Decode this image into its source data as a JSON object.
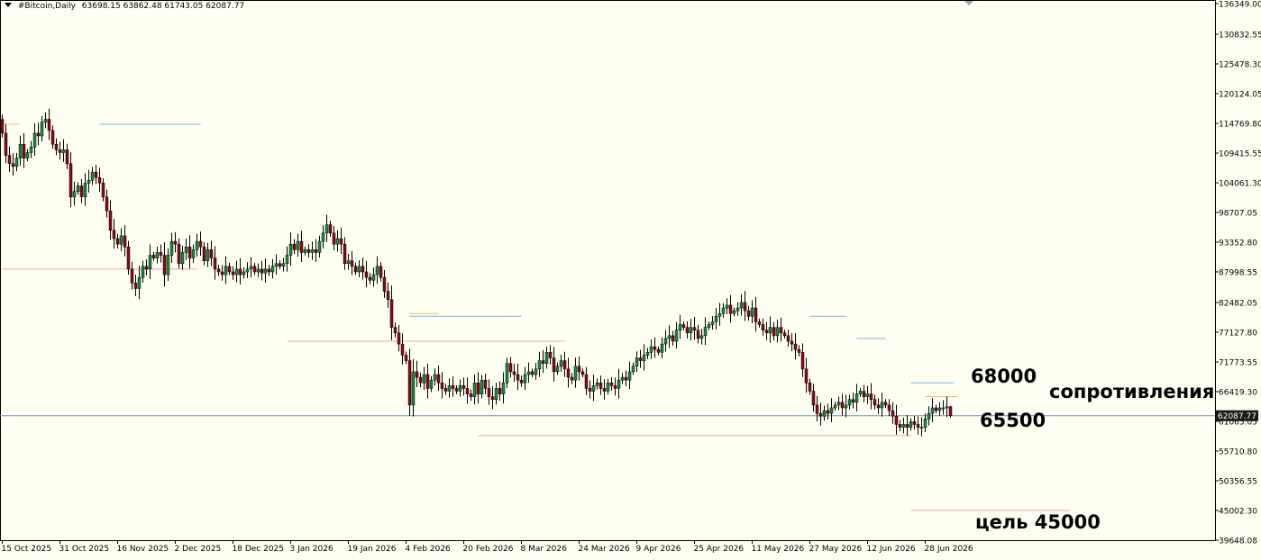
{
  "header": {
    "symbol": "#Bitcoin,Daily",
    "ohlc": "63698.15 63862.48 61743.05 62087.77"
  },
  "colors": {
    "background": "#fffff2",
    "bull": "#1e8c3a",
    "bear": "#8b0a17",
    "wick": "#000000",
    "current_price_line": "#7a8fb8",
    "current_price_box": "#1a1a1a",
    "level_orange": "#f0b860",
    "level_blue": "#7fb3e6",
    "level_red": "#f0a8a8"
  },
  "annotations": {
    "a68000": "68000",
    "a65500": "65500",
    "resistance": "сопротивления",
    "target": "цель 45000"
  },
  "chart_data": {
    "type": "candlestick",
    "timeframe": "Daily",
    "symbol": "#Bitcoin",
    "current_price": 62087.77,
    "current_price_label": "62087.77",
    "ylim": [
      39648.08,
      136349.0
    ],
    "y_ticks": [
      {
        "v": 136349.0,
        "label": "136349.00"
      },
      {
        "v": 130832.55,
        "label": "130832.55"
      },
      {
        "v": 125478.3,
        "label": "125478.30"
      },
      {
        "v": 120124.05,
        "label": "120124.05"
      },
      {
        "v": 114769.8,
        "label": "114769.80"
      },
      {
        "v": 109415.55,
        "label": "109415.55"
      },
      {
        "v": 104061.3,
        "label": "104061.30"
      },
      {
        "v": 98707.05,
        "label": "98707.05"
      },
      {
        "v": 93352.8,
        "label": "93352.80"
      },
      {
        "v": 87998.55,
        "label": "87998.55"
      },
      {
        "v": 82482.05,
        "label": "82482.05"
      },
      {
        "v": 77127.8,
        "label": "77127.80"
      },
      {
        "v": 71773.55,
        "label": "71773.55"
      },
      {
        "v": 66419.3,
        "label": "66419.30"
      },
      {
        "v": 61065.05,
        "label": "61065.05"
      },
      {
        "v": 55710.8,
        "label": "55710.80"
      },
      {
        "v": 50356.55,
        "label": "50356.55"
      },
      {
        "v": 45002.3,
        "label": "45002.30"
      },
      {
        "v": 39648.08,
        "label": "39648.08"
      }
    ],
    "x_labels": [
      "15 Oct 2025",
      "31 Oct 2025",
      "16 Nov 2025",
      "2 Dec 2025",
      "18 Dec 2025",
      "3 Jan 2026",
      "19 Jan 2026",
      "4 Feb 2026",
      "20 Feb 2026",
      "8 Mar 2026",
      "24 Mar 2026",
      "9 Apr 2026",
      "25 Apr 2026",
      "11 May 2026",
      "27 May 2026",
      "12 Jun 2026",
      "28 Jun 2026"
    ],
    "dates": [
      "2025-10-15",
      "2025-10-16",
      "2025-10-17",
      "2025-10-18",
      "2025-10-19",
      "2025-10-20",
      "2025-10-21",
      "2025-10-22",
      "2025-10-23",
      "2025-10-24",
      "2025-10-25",
      "2025-10-26",
      "2025-10-27",
      "2025-10-28",
      "2025-10-29",
      "2025-10-30",
      "2025-10-31",
      "2025-11-01",
      "2025-11-02",
      "2025-11-03",
      "2025-11-04",
      "2025-11-05",
      "2025-11-06",
      "2025-11-07",
      "2025-11-08",
      "2025-11-09",
      "2025-11-10",
      "2025-11-11",
      "2025-11-12",
      "2025-11-13",
      "2025-11-14",
      "2025-11-15",
      "2025-11-16",
      "2025-11-17",
      "2025-11-18",
      "2025-11-19",
      "2025-11-20",
      "2025-11-21",
      "2025-11-22",
      "2025-11-23",
      "2025-11-24",
      "2025-11-25",
      "2025-11-26",
      "2025-11-27",
      "2025-11-28",
      "2025-11-29",
      "2025-11-30",
      "2025-12-01",
      "2025-12-02",
      "2025-12-03",
      "2025-12-04",
      "2025-12-05",
      "2025-12-06",
      "2025-12-07",
      "2025-12-08",
      "2025-12-09",
      "2025-12-10",
      "2025-12-11",
      "2025-12-12",
      "2025-12-13",
      "2025-12-14",
      "2025-12-15",
      "2025-12-16",
      "2025-12-17",
      "2025-12-18",
      "2025-12-19",
      "2025-12-20",
      "2025-12-21",
      "2025-12-22",
      "2025-12-23",
      "2025-12-24",
      "2025-12-25",
      "2025-12-26",
      "2025-12-27",
      "2025-12-28",
      "2025-12-29",
      "2025-12-30",
      "2025-12-31",
      "2026-01-01",
      "2026-01-02",
      "2026-01-03",
      "2026-01-04",
      "2026-01-05",
      "2026-01-06",
      "2026-01-07",
      "2026-01-08",
      "2026-01-09",
      "2026-01-10",
      "2026-01-11",
      "2026-01-12",
      "2026-01-13",
      "2026-01-14",
      "2026-01-15",
      "2026-01-16",
      "2026-01-17",
      "2026-01-18",
      "2026-01-19",
      "2026-01-20",
      "2026-01-21",
      "2026-01-22",
      "2026-01-23",
      "2026-01-24",
      "2026-01-25",
      "2026-01-26",
      "2026-01-27",
      "2026-01-28",
      "2026-01-29",
      "2026-01-30",
      "2026-01-31",
      "2026-02-01",
      "2026-02-02",
      "2026-02-03",
      "2026-02-04",
      "2026-02-05",
      "2026-02-06",
      "2026-02-07",
      "2026-02-08",
      "2026-02-09",
      "2026-02-10",
      "2026-02-11",
      "2026-02-12",
      "2026-02-13",
      "2026-02-14",
      "2026-02-15",
      "2026-02-16",
      "2026-02-17",
      "2026-02-18",
      "2026-02-19",
      "2026-02-20",
      "2026-02-21",
      "2026-02-22",
      "2026-02-23",
      "2026-02-24",
      "2026-02-25",
      "2026-02-26",
      "2026-02-27",
      "2026-02-28",
      "2026-03-01",
      "2026-03-02",
      "2026-03-03",
      "2026-03-04",
      "2026-03-05",
      "2026-03-06",
      "2026-03-07",
      "2026-03-08",
      "2026-03-09",
      "2026-03-10",
      "2026-03-11",
      "2026-03-12",
      "2026-03-13",
      "2026-03-14",
      "2026-03-15",
      "2026-03-16",
      "2026-03-17",
      "2026-03-18",
      "2026-03-19",
      "2026-03-20",
      "2026-03-21",
      "2026-03-22",
      "2026-03-23",
      "2026-03-24",
      "2026-03-25",
      "2026-03-26",
      "2026-03-27",
      "2026-03-28",
      "2026-03-29",
      "2026-03-30",
      "2026-03-31",
      "2026-04-01",
      "2026-04-02",
      "2026-04-03",
      "2026-04-04",
      "2026-04-05",
      "2026-04-06",
      "2026-04-07",
      "2026-04-08",
      "2026-04-09",
      "2026-04-10",
      "2026-04-11",
      "2026-04-12",
      "2026-04-13",
      "2026-04-14",
      "2026-04-15",
      "2026-04-16",
      "2026-04-17",
      "2026-04-18",
      "2026-04-19",
      "2026-04-20",
      "2026-04-21",
      "2026-04-22",
      "2026-04-23",
      "2026-04-24",
      "2026-04-25",
      "2026-04-26",
      "2026-04-27",
      "2026-04-28",
      "2026-04-29",
      "2026-04-30",
      "2026-05-01",
      "2026-05-02",
      "2026-05-03",
      "2026-05-04",
      "2026-05-05",
      "2026-05-06",
      "2026-05-07",
      "2026-05-08",
      "2026-05-09",
      "2026-05-10",
      "2026-05-11",
      "2026-05-12",
      "2026-05-13",
      "2026-05-14",
      "2026-05-15",
      "2026-05-16",
      "2026-05-17",
      "2026-05-18",
      "2026-05-19",
      "2026-05-20",
      "2026-05-21",
      "2026-05-22",
      "2026-05-23",
      "2026-05-24",
      "2026-05-25",
      "2026-05-26",
      "2026-05-27",
      "2026-05-28",
      "2026-05-29",
      "2026-05-30",
      "2026-05-31",
      "2026-06-01",
      "2026-06-02",
      "2026-06-03",
      "2026-06-04",
      "2026-06-05",
      "2026-06-06",
      "2026-06-07",
      "2026-06-08",
      "2026-06-09",
      "2026-06-10",
      "2026-06-11",
      "2026-06-12",
      "2026-06-13",
      "2026-06-14",
      "2026-06-15",
      "2026-06-16",
      "2026-06-17",
      "2026-06-18",
      "2026-06-19",
      "2026-06-20",
      "2026-06-21",
      "2026-06-22",
      "2026-06-23",
      "2026-06-24",
      "2026-06-25",
      "2026-06-26",
      "2026-06-27",
      "2026-06-28",
      "2026-06-29",
      "2026-06-30",
      "2026-07-01",
      "2026-07-02",
      "2026-07-03",
      "2026-07-04",
      "2026-07-05",
      "2026-07-06",
      "2026-07-07",
      "2026-07-08",
      "2026-07-09",
      "2026-07-10"
    ],
    "close": [
      113000,
      109000,
      107500,
      107000,
      108500,
      111000,
      108500,
      109500,
      110500,
      113000,
      112500,
      115000,
      115500,
      113500,
      111000,
      110000,
      109500,
      110000,
      107500,
      101500,
      102500,
      103500,
      101500,
      104000,
      104500,
      106000,
      105000,
      104000,
      101500,
      99000,
      95500,
      94000,
      93000,
      94500,
      92500,
      88500,
      86000,
      85000,
      87000,
      89000,
      88500,
      91000,
      90500,
      91500,
      91000,
      87500,
      91000,
      93500,
      93000,
      89500,
      91500,
      92500,
      90500,
      92000,
      93500,
      92500,
      90000,
      92000,
      90500,
      88500,
      88000,
      87500,
      89000,
      88000,
      87500,
      88500,
      87500,
      88000,
      88500,
      89000,
      88000,
      88500,
      87800,
      88500,
      88000,
      89000,
      89500,
      89000,
      89500,
      91000,
      93000,
      92000,
      93500,
      91500,
      92000,
      91500,
      92000,
      91500,
      93500,
      95000,
      96500,
      95000,
      93000,
      94000,
      93000,
      89500,
      90000,
      89000,
      88000,
      89000,
      88000,
      87000,
      86500,
      87500,
      89000,
      87000,
      84500,
      83000,
      78000,
      77000,
      75000,
      73000,
      72000,
      64000,
      70000,
      69000,
      68000,
      69500,
      67000,
      68500,
      69500,
      68000,
      67000,
      66500,
      67500,
      67000,
      66500,
      67500,
      67000,
      66000,
      65500,
      68000,
      66000,
      68500,
      67000,
      65500,
      65000,
      67000,
      66000,
      68000,
      71500,
      70000,
      69500,
      68500,
      68000,
      69500,
      70000,
      69500,
      70500,
      72000,
      71500,
      73500,
      72500,
      70000,
      71000,
      72000,
      70500,
      69000,
      68500,
      71000,
      70000,
      69500,
      67000,
      66500,
      67500,
      68000,
      67000,
      66500,
      68000,
      67500,
      67000,
      68500,
      69000,
      68500,
      70000,
      71000,
      72500,
      72000,
      73000,
      73500,
      74500,
      74000,
      73500,
      75000,
      76000,
      76500,
      75500,
      77500,
      78500,
      78000,
      77000,
      78000,
      77500,
      76000,
      76500,
      78000,
      78500,
      79000,
      80000,
      80500,
      81500,
      82000,
      80500,
      81000,
      81500,
      82500,
      81000,
      80000,
      81500,
      79000,
      78500,
      77500,
      77000,
      78000,
      76500,
      78000,
      77000,
      76500,
      75500,
      75000,
      74000,
      73500,
      70500,
      68000,
      66500,
      64000,
      62500,
      62000,
      63000,
      62500,
      63500,
      64000,
      64500,
      63500,
      64000,
      65000,
      64500,
      66000,
      66500,
      65500,
      66000,
      65000,
      64000,
      63500,
      64500,
      64000,
      63000,
      62000,
      60500,
      60000,
      60500,
      60000,
      61000,
      60500,
      60000,
      60000,
      61500,
      62500,
      63500,
      63000,
      63500,
      63500,
      63698.15,
      62087.77
    ]
  },
  "levels": [
    {
      "kind": "resistance",
      "value": 68000,
      "color": "blue",
      "start": "2026-06-24",
      "end": "2026-07-06"
    },
    {
      "kind": "resistance",
      "value": 65500,
      "color": "orange",
      "start": "2026-06-28",
      "end": "2026-07-07"
    },
    {
      "kind": "support",
      "value": 58500,
      "color": "red",
      "start": "2026-02-24",
      "end": "2026-06-24"
    },
    {
      "kind": "target",
      "value": 45000,
      "color": "red",
      "start": "2026-06-24",
      "end": "2026-08-07"
    },
    {
      "kind": "level",
      "value": 88500,
      "color": "red",
      "start": "2025-10-15",
      "end": "2025-12-08"
    },
    {
      "kind": "level",
      "value": 75500,
      "color": "red",
      "start": "2026-01-02",
      "end": "2026-03-20"
    },
    {
      "kind": "level",
      "value": 80000,
      "color": "blue",
      "start": "2026-02-05",
      "end": "2026-03-08"
    },
    {
      "kind": "level",
      "value": 80500,
      "color": "orange",
      "start": "2026-02-05",
      "end": "2026-02-13"
    },
    {
      "kind": "level",
      "value": 114600,
      "color": "blue",
      "start": "2025-11-11",
      "end": "2025-12-09"
    },
    {
      "kind": "level",
      "value": 114600,
      "color": "orange",
      "start": "2025-10-15",
      "end": "2025-10-20"
    },
    {
      "kind": "level",
      "value": 80000,
      "color": "blue",
      "start": "2026-05-27",
      "end": "2026-06-06"
    },
    {
      "kind": "level",
      "value": 76000,
      "color": "blue",
      "start": "2026-06-09",
      "end": "2026-06-17"
    }
  ]
}
